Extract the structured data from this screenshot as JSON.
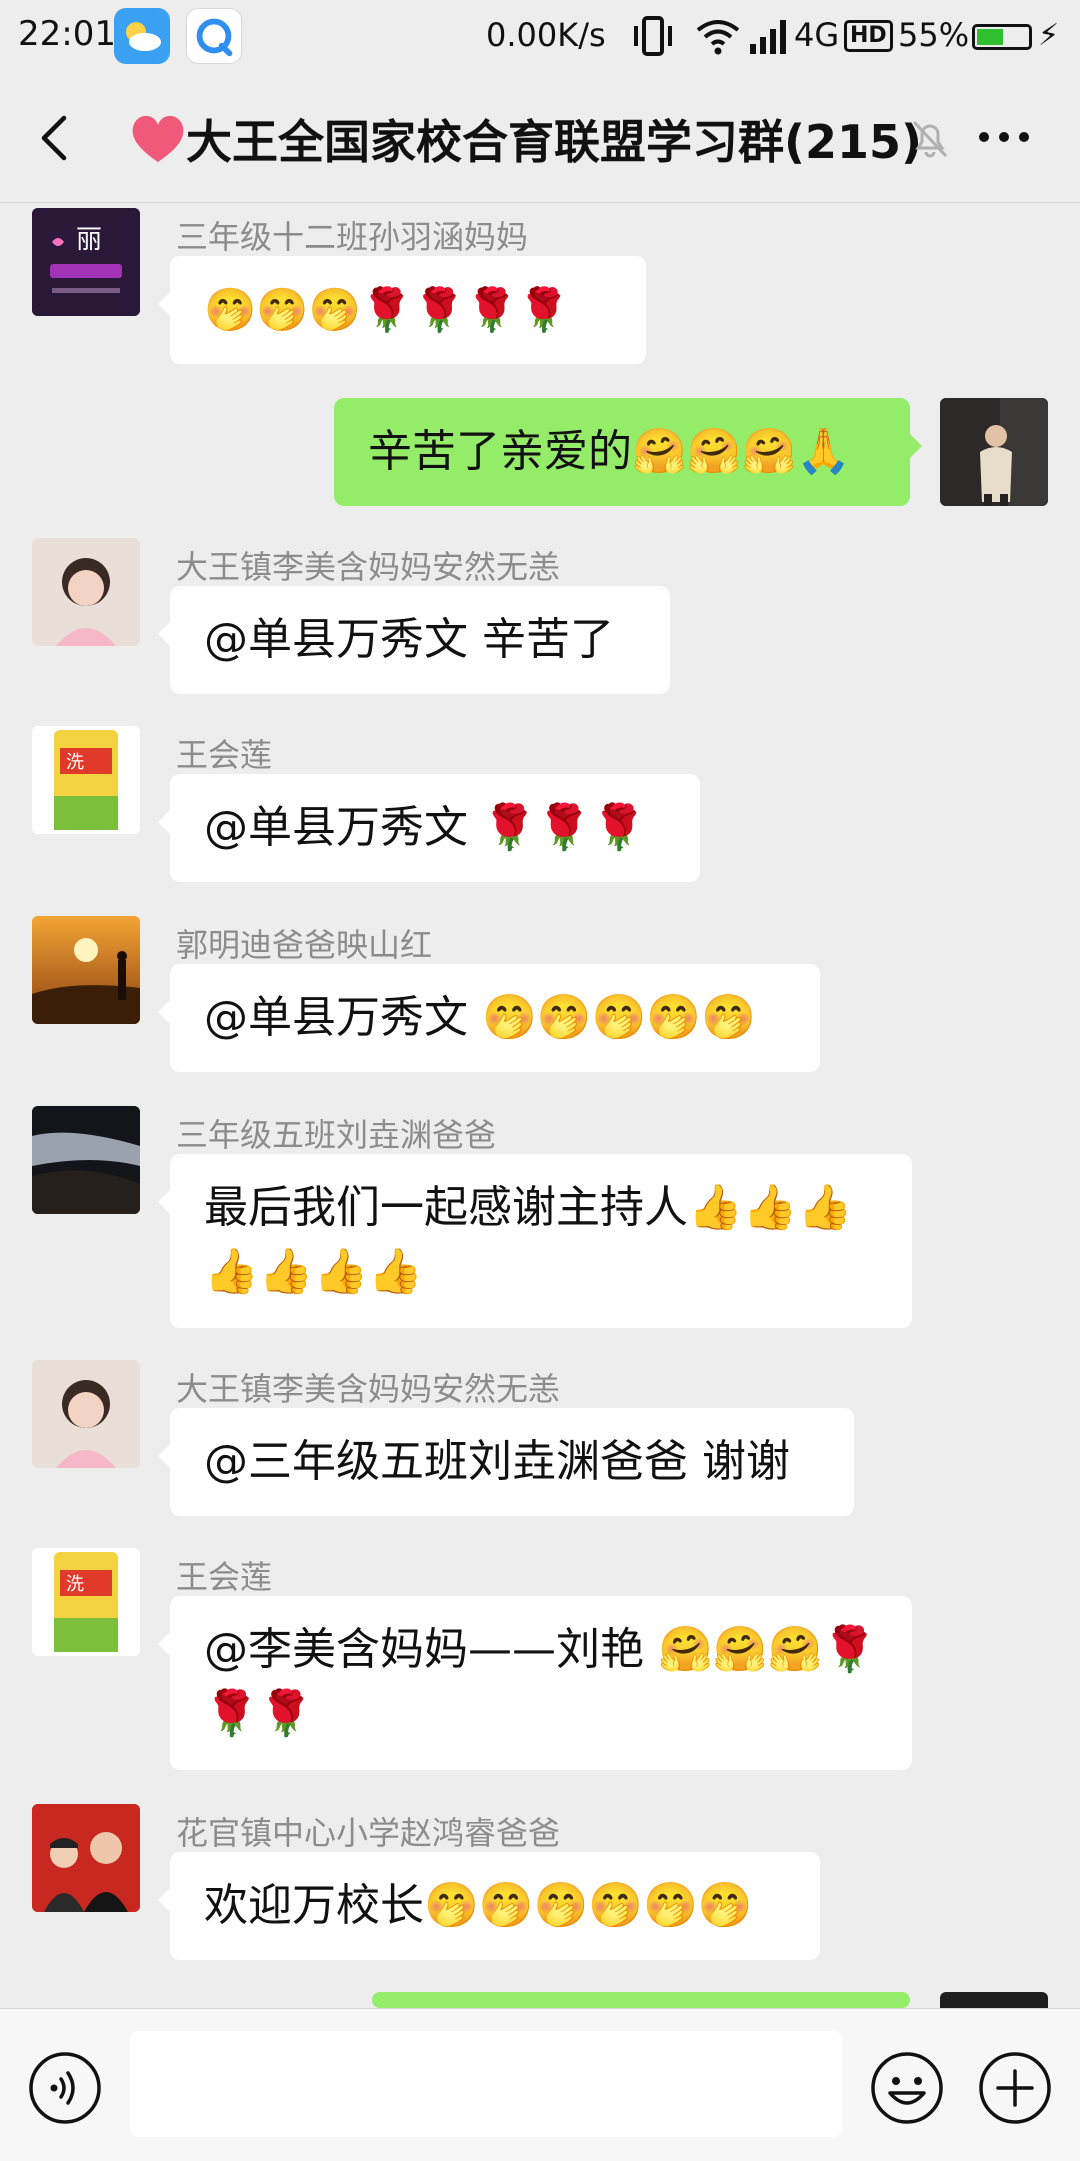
{
  "status_bar": {
    "time": "22:01",
    "net_speed": "0.00K/s",
    "network": "4G",
    "hd": "HD",
    "battery": "55%",
    "battery_level": 0.55,
    "icons": [
      "weather-app-icon",
      "browser-app-icon",
      "vibrate-icon",
      "wifi-icon",
      "signal-icon",
      "battery-icon",
      "charging-icon"
    ]
  },
  "header": {
    "title": "大王全国家校合育联盟学习群(215)",
    "icons": [
      "back-icon",
      "heart-icon",
      "mute-icon",
      "more-icon"
    ]
  },
  "messages": [
    {
      "sender": "三年级十二班孙羽涵妈妈",
      "text": "🤭🤭🤭🌹🌹🌹🌹"
    },
    {
      "sender": "",
      "text": "辛苦了亲爱的🤗🤗🤗🙏",
      "mine": true
    },
    {
      "sender": "大王镇李美含妈妈安然无恙",
      "text": "@单县万秀文  辛苦了"
    },
    {
      "sender": "王会莲",
      "text": "@单县万秀文 🌹🌹🌹"
    },
    {
      "sender": "郭明迪爸爸映山红",
      "text": "@单县万秀文 🤭🤭🤭🤭🤭"
    },
    {
      "sender": "三年级五班刘垚渊爸爸",
      "text": "最后我们一起感谢主持人👍👍👍👍👍👍👍"
    },
    {
      "sender": "大王镇李美含妈妈安然无恙",
      "text": "@三年级五班刘垚渊爸爸  谢谢"
    },
    {
      "sender": "王会莲",
      "text": "@李美含妈妈——刘艳 🤗🤗🤗🌹🌹🌹"
    },
    {
      "sender": "花官镇中心小学赵鸿睿爸爸",
      "text": "欢迎万校长🤭🤭🤭🤭🤭🤭"
    }
  ],
  "input_bar": {
    "placeholder": "",
    "icons": [
      "voice-icon",
      "emoji-icon",
      "plus-icon"
    ]
  }
}
